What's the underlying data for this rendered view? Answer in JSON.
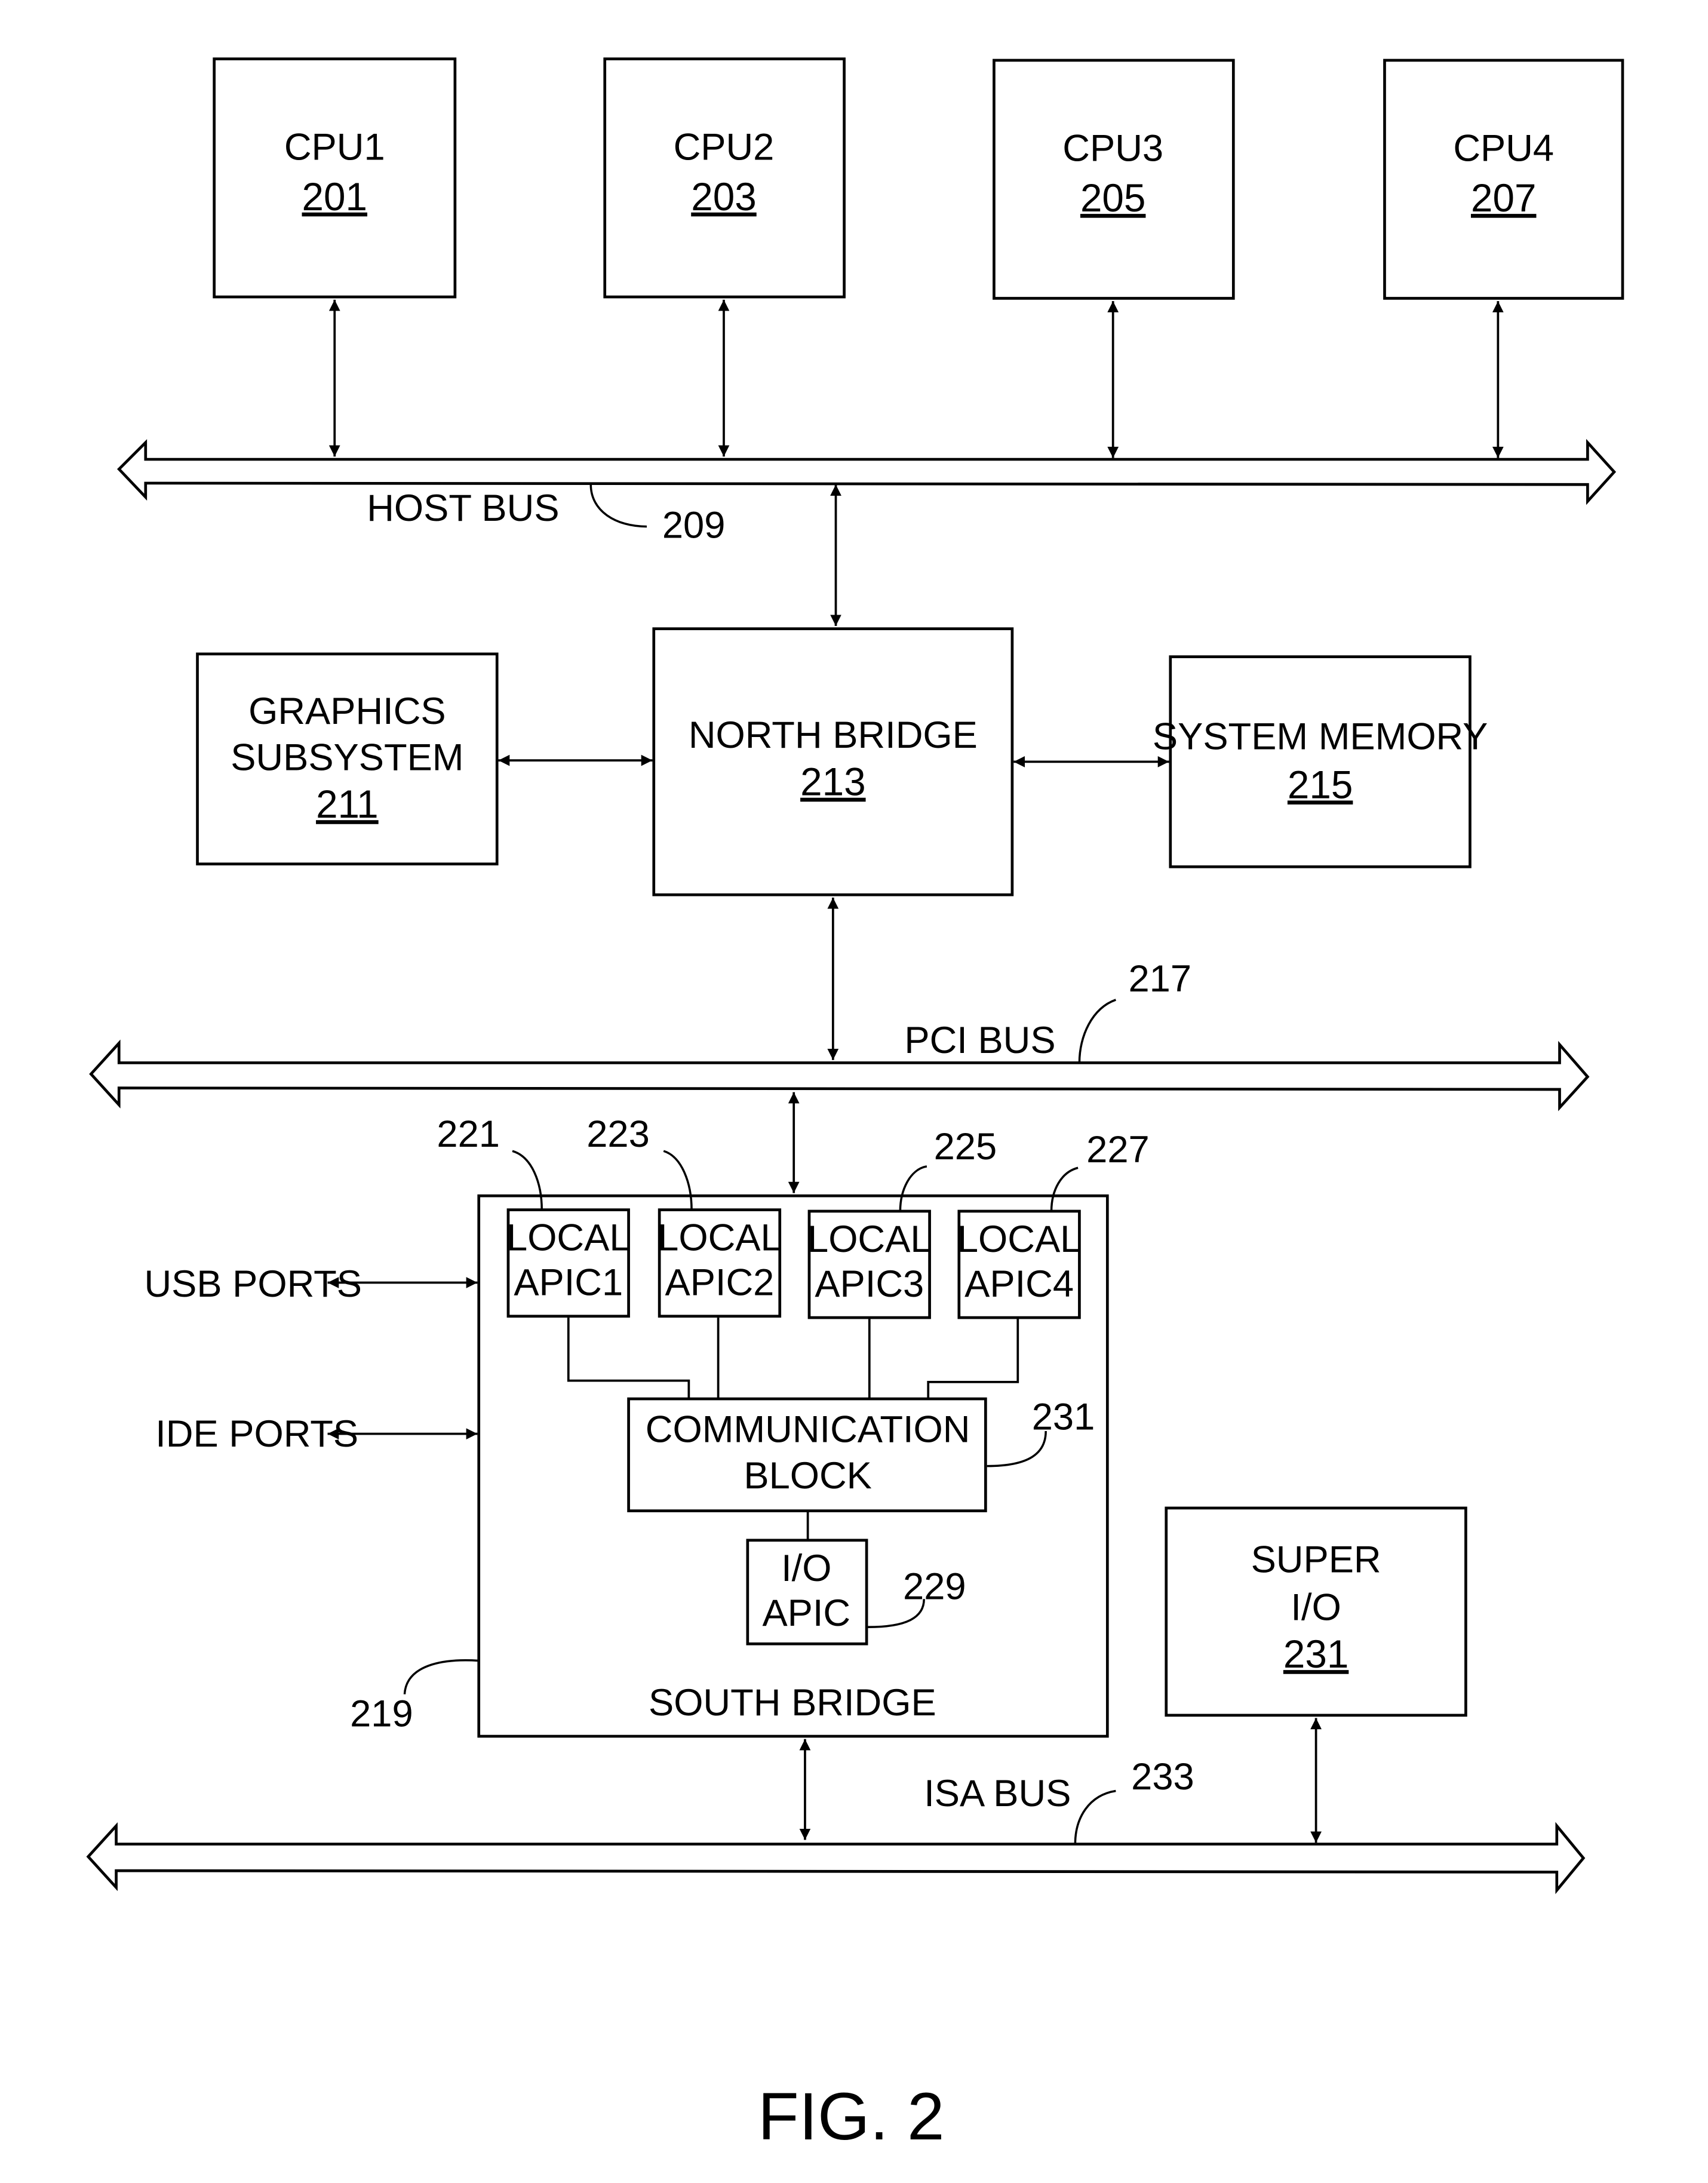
{
  "figure": {
    "caption": "FIG. 2",
    "cpus": [
      {
        "name": "CPU1",
        "ref": "201"
      },
      {
        "name": "CPU2",
        "ref": "203"
      },
      {
        "name": "CPU3",
        "ref": "205"
      },
      {
        "name": "CPU4",
        "ref": "207"
      }
    ],
    "host_bus": {
      "label": "HOST BUS",
      "ref": "209"
    },
    "graphics": {
      "line1": "GRAPHICS",
      "line2": "SUBSYSTEM",
      "ref": "211"
    },
    "north_bridge": {
      "label": "NORTH BRIDGE",
      "ref": "213"
    },
    "system_memory": {
      "label": "SYSTEM MEMORY",
      "ref": "215"
    },
    "pci_bus": {
      "label": "PCI BUS",
      "ref": "217"
    },
    "south_bridge": {
      "label": "SOUTH BRIDGE",
      "ref": "219"
    },
    "local_apics": [
      {
        "line1": "LOCAL",
        "line2": "APIC1",
        "ref": "221"
      },
      {
        "line1": "LOCAL",
        "line2": "APIC2",
        "ref": "223"
      },
      {
        "line1": "LOCAL",
        "line2": "APIC3",
        "ref": "225"
      },
      {
        "line1": "LOCAL",
        "line2": "APIC4",
        "ref": "227"
      }
    ],
    "communication_block": {
      "line1": "COMMUNICATION",
      "line2": "BLOCK",
      "ref": "231"
    },
    "io_apic": {
      "line1": "I/O",
      "line2": "APIC",
      "ref": "229"
    },
    "usb_ports": "USB PORTS",
    "ide_ports": "IDE PORTS",
    "super_io": {
      "line1": "SUPER",
      "line2": "I/O",
      "ref": "231"
    },
    "isa_bus": {
      "label": "ISA BUS",
      "ref": "233"
    }
  }
}
